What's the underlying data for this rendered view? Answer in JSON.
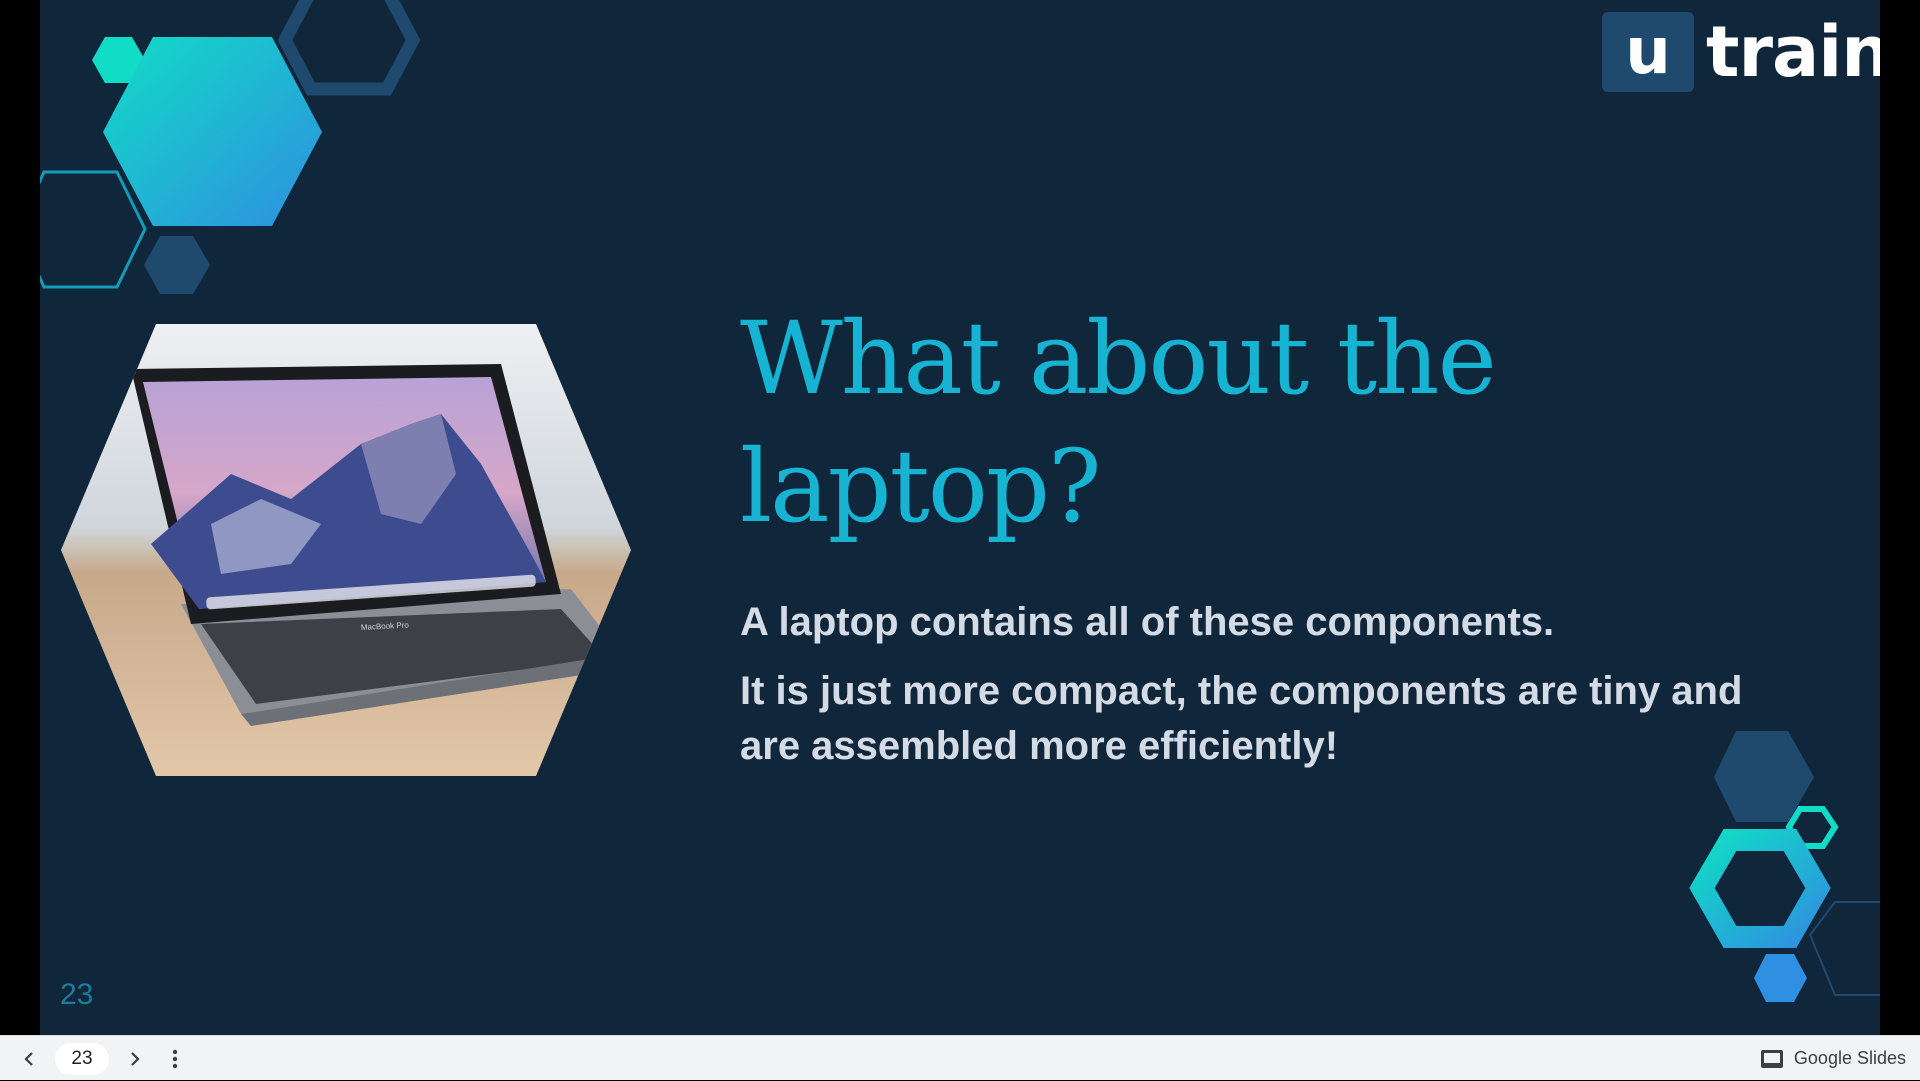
{
  "slide": {
    "title": "What about the laptop?",
    "paragraph_1": "A laptop contains all of these components.",
    "paragraph_2": "It is just more compact, the components are tiny and are assembled more efficiently!",
    "number": "23"
  },
  "logo": {
    "letter": "u",
    "word": "train"
  },
  "image": {
    "subject": "laptop-photo",
    "screen_label": "MacBook Pro"
  },
  "toolbar": {
    "current_page": "23",
    "brand": "Google Slides",
    "icons": [
      "chevron-left-icon",
      "chevron-right-icon",
      "more-vertical-icon",
      "slides-icon"
    ]
  },
  "colors": {
    "background": "#10263b",
    "accent_teal": "#16b3d3",
    "accent_aqua": "#11dcc6",
    "hex_dark": "#1f4a6e",
    "body_text": "#d5dbe5",
    "toolbar_bg": "#f1f3f4"
  }
}
